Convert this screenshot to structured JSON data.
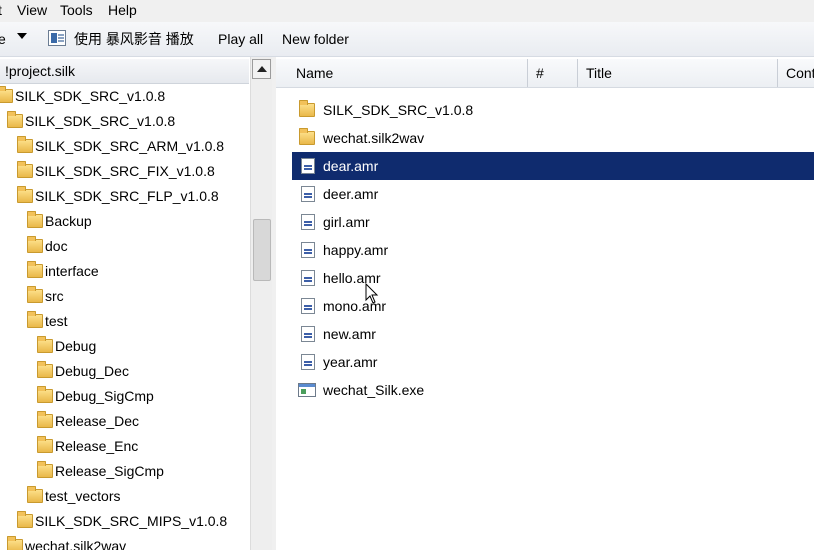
{
  "menubar": {
    "items": [
      "t",
      "View",
      "Tools",
      "Help"
    ]
  },
  "toolbar": {
    "first_fragment": "e",
    "play_with": "使用 暴风影音 播放",
    "play_all": "Play all",
    "new_folder": "New folder"
  },
  "tree": {
    "header": "!project.silk",
    "items": [
      {
        "label": "SILK_SDK_SRC_v1.0.8"
      },
      {
        "label": "SILK_SDK_SRC_v1.0.8"
      },
      {
        "label": "SILK_SDK_SRC_ARM_v1.0.8"
      },
      {
        "label": "SILK_SDK_SRC_FIX_v1.0.8"
      },
      {
        "label": "SILK_SDK_SRC_FLP_v1.0.8"
      },
      {
        "label": "Backup"
      },
      {
        "label": "doc"
      },
      {
        "label": "interface"
      },
      {
        "label": "src"
      },
      {
        "label": "test"
      },
      {
        "label": "Debug"
      },
      {
        "label": "Debug_Dec"
      },
      {
        "label": "Debug_SigCmp"
      },
      {
        "label": "Release_Dec"
      },
      {
        "label": "Release_Enc"
      },
      {
        "label": "Release_SigCmp"
      },
      {
        "label": "test_vectors"
      },
      {
        "label": "SILK_SDK_SRC_MIPS_v1.0.8"
      },
      {
        "label": "wechat.silk2wav"
      }
    ]
  },
  "columns": [
    "Name",
    "#",
    "Title",
    "Cont"
  ],
  "files": [
    {
      "name": "SILK_SDK_SRC_v1.0.8",
      "icon": "folder-icon"
    },
    {
      "name": "wechat.silk2wav",
      "icon": "folder-icon"
    },
    {
      "name": "dear.amr",
      "icon": "audio-file-icon",
      "selected": true
    },
    {
      "name": "deer.amr",
      "icon": "audio-file-icon"
    },
    {
      "name": "girl.amr",
      "icon": "audio-file-icon"
    },
    {
      "name": "happy.amr",
      "icon": "audio-file-icon"
    },
    {
      "name": "hello.amr",
      "icon": "audio-file-icon"
    },
    {
      "name": "mono.amr",
      "icon": "audio-file-icon"
    },
    {
      "name": "new.amr",
      "icon": "audio-file-icon"
    },
    {
      "name": "year.amr",
      "icon": "audio-file-icon"
    },
    {
      "name": "wechat_Silk.exe",
      "icon": "application-icon"
    }
  ],
  "colors": {
    "selection": "#0f2b6e",
    "selection_text": "#ffffff"
  }
}
